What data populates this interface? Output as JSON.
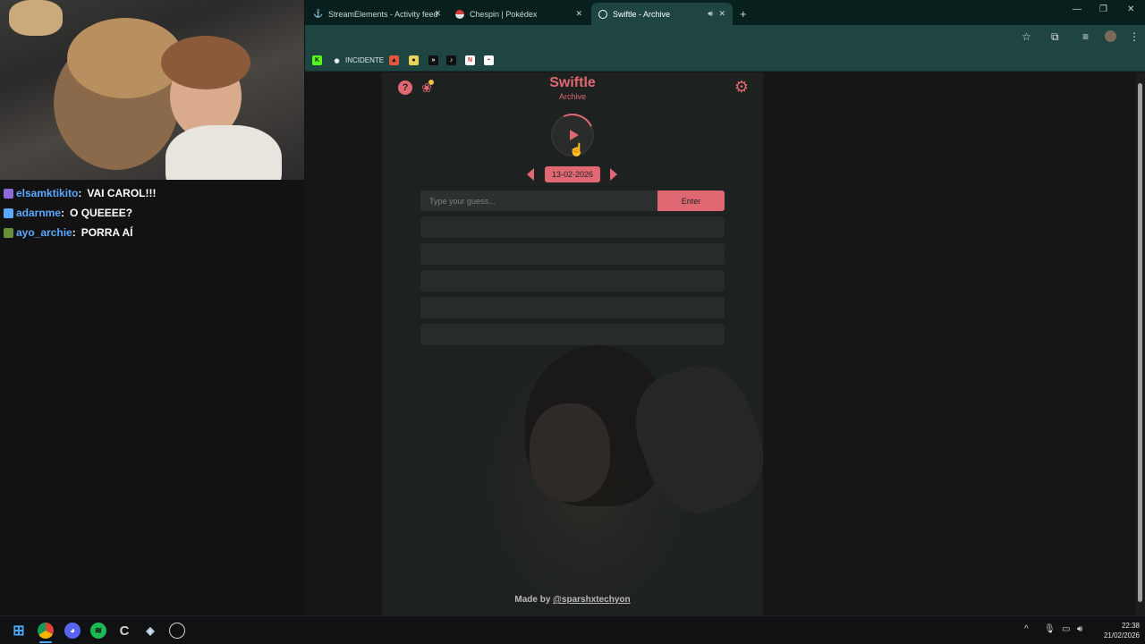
{
  "chat": {
    "lines": [
      {
        "user": "elsamktikito",
        "separator": ":",
        "message": "VAI CAROL!!!",
        "user_color": "#5aa8ff",
        "badge_color": "#8c6ad8"
      },
      {
        "user": "adarnme",
        "separator": ":",
        "message": "O QUEEEE?",
        "user_color": "#5aa8ff",
        "badge_color": "#5aa8ff"
      },
      {
        "user": "ayo_archie",
        "separator": ":",
        "message": "PORRA AÍ",
        "user_color": "#5aa8ff",
        "badge_color": "#6a8f3a"
      }
    ]
  },
  "browser": {
    "tabs": [
      {
        "label": "StreamElements - Activity feed",
        "icon": "streamelements-icon"
      },
      {
        "label": "Chespin | Pokédex",
        "icon": "pokeball-icon"
      },
      {
        "label": "Swiftle - Archive",
        "icon": "swiftle-icon",
        "active": true
      }
    ],
    "new_tab": "+",
    "bookmarks": [
      {
        "label": "",
        "icon": "kick-icon",
        "color": "#53fc18"
      },
      {
        "label": "INCIDENTE",
        "icon": "incidente-icon",
        "color": "#1f4543"
      },
      {
        "label": "",
        "icon": "fire-icon",
        "color": "#e2553f"
      },
      {
        "label": "",
        "icon": "pill-icon",
        "color": "#e7d35a"
      },
      {
        "label": "",
        "icon": "forward-icon",
        "color": "#101010"
      },
      {
        "label": "",
        "icon": "tiktok-icon",
        "color": "#101010"
      },
      {
        "label": "",
        "icon": "notion-icon",
        "color": "#ffffff"
      },
      {
        "label": "",
        "icon": "pokeball-icon",
        "color": "#ffffff"
      }
    ]
  },
  "app": {
    "title": "Swiftle",
    "subtitle": "Archive",
    "date": "13-02-2026",
    "guess_placeholder": "Type your guess...",
    "enter_label": "Enter",
    "guess_rows": 5,
    "footer_prefix": "Made by ",
    "footer_author": "@sparshxtechyon",
    "accent": "#e06872"
  },
  "taskbar": {
    "time": "22:38",
    "date": "21/02/2026",
    "apps": [
      "windows-start-icon",
      "chrome-icon",
      "discord-icon",
      "spotify-icon",
      "ccleaner-icon",
      "steam-icon",
      "obs-icon"
    ]
  }
}
